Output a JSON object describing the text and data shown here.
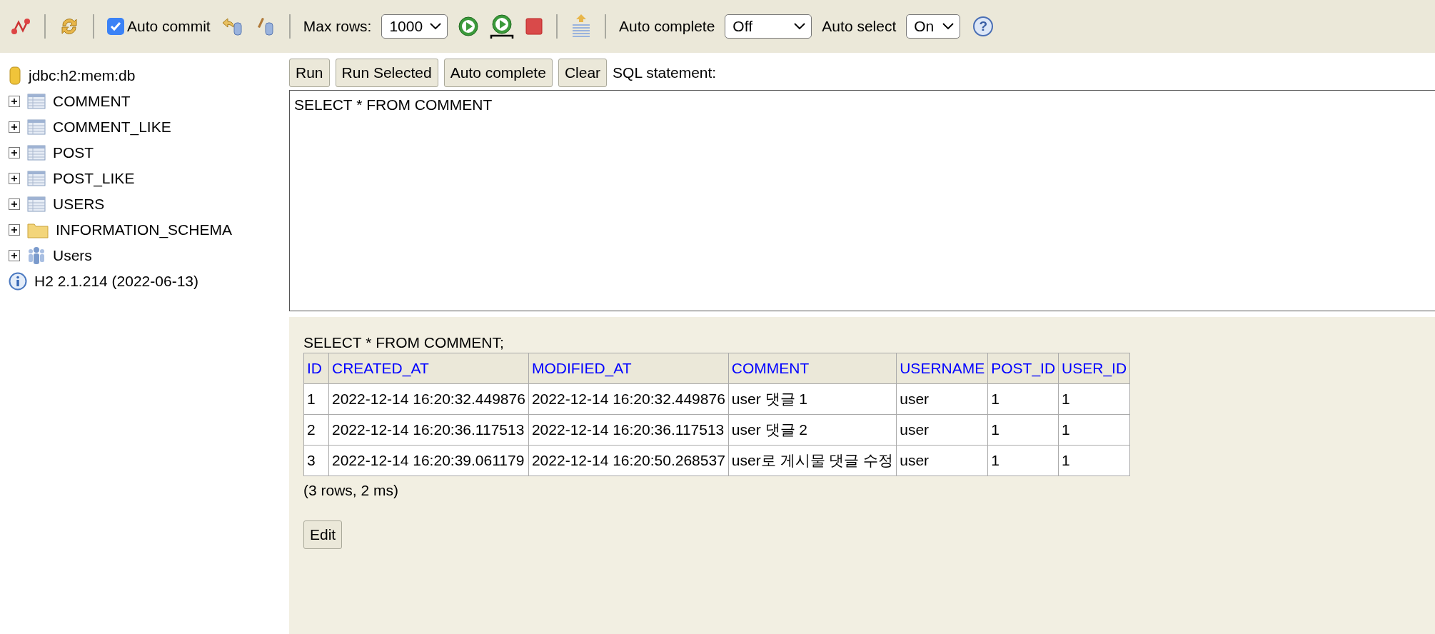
{
  "toolbar": {
    "items": [
      {
        "kind": "icon"
      },
      {
        "kind": "separator"
      },
      {
        "kind": "icon"
      },
      {
        "kind": "separator"
      },
      {
        "kind": "checkbox",
        "label": "Auto commit",
        "checked": true
      },
      {
        "kind": "icon"
      },
      {
        "kind": "icon"
      },
      {
        "kind": "separator"
      },
      {
        "kind": "select",
        "label": "Max rows:",
        "value": "1000"
      },
      {
        "kind": "icon"
      },
      {
        "kind": "icon"
      },
      {
        "kind": "icon"
      },
      {
        "kind": "separator"
      },
      {
        "kind": "icon"
      },
      {
        "kind": "separator"
      },
      {
        "kind": "select",
        "label": "Auto complete",
        "value": "Off"
      },
      {
        "kind": "select",
        "label": "Auto select",
        "value": "On"
      },
      {
        "kind": "help",
        "label": "?"
      }
    ]
  },
  "tree": {
    "connection": "jdbc:h2:mem:db",
    "items": [
      {
        "kind": "table",
        "label": "COMMENT",
        "expanded": false
      },
      {
        "kind": "table",
        "label": "COMMENT_LIKE",
        "expanded": false
      },
      {
        "kind": "table",
        "label": "POST",
        "expanded": false
      },
      {
        "kind": "table",
        "label": "POST_LIKE",
        "expanded": false
      },
      {
        "kind": "table",
        "label": "USERS",
        "expanded": false
      },
      {
        "kind": "folder",
        "label": "INFORMATION_SCHEMA",
        "expanded": false
      },
      {
        "kind": "users",
        "label": "Users",
        "expanded": false
      }
    ],
    "version": "H2 2.1.214 (2022-06-13)"
  },
  "editor": {
    "buttons": [
      "Run",
      "Run Selected",
      "Auto complete",
      "Clear"
    ],
    "label": "SQL statement:",
    "value": "SELECT * FROM COMMENT"
  },
  "result": {
    "query": "SELECT * FROM COMMENT;",
    "columns": [
      "ID",
      "CREATED_AT",
      "MODIFIED_AT",
      "COMMENT",
      "USERNAME",
      "POST_ID",
      "USER_ID"
    ],
    "rows": [
      [
        "1",
        "2022-12-14 16:20:32.449876",
        "2022-12-14 16:20:32.449876",
        "user 댓글 1",
        "user",
        "1",
        "1"
      ],
      [
        "2",
        "2022-12-14 16:20:36.117513",
        "2022-12-14 16:20:36.117513",
        "user 댓글 2",
        "user",
        "1",
        "1"
      ],
      [
        "3",
        "2022-12-14 16:20:39.061179",
        "2022-12-14 16:20:50.268537",
        "user로 게시물 댓글 수정",
        "user",
        "1",
        "1"
      ]
    ],
    "summary": "(3 rows, 2 ms)",
    "edit_button": "Edit"
  }
}
